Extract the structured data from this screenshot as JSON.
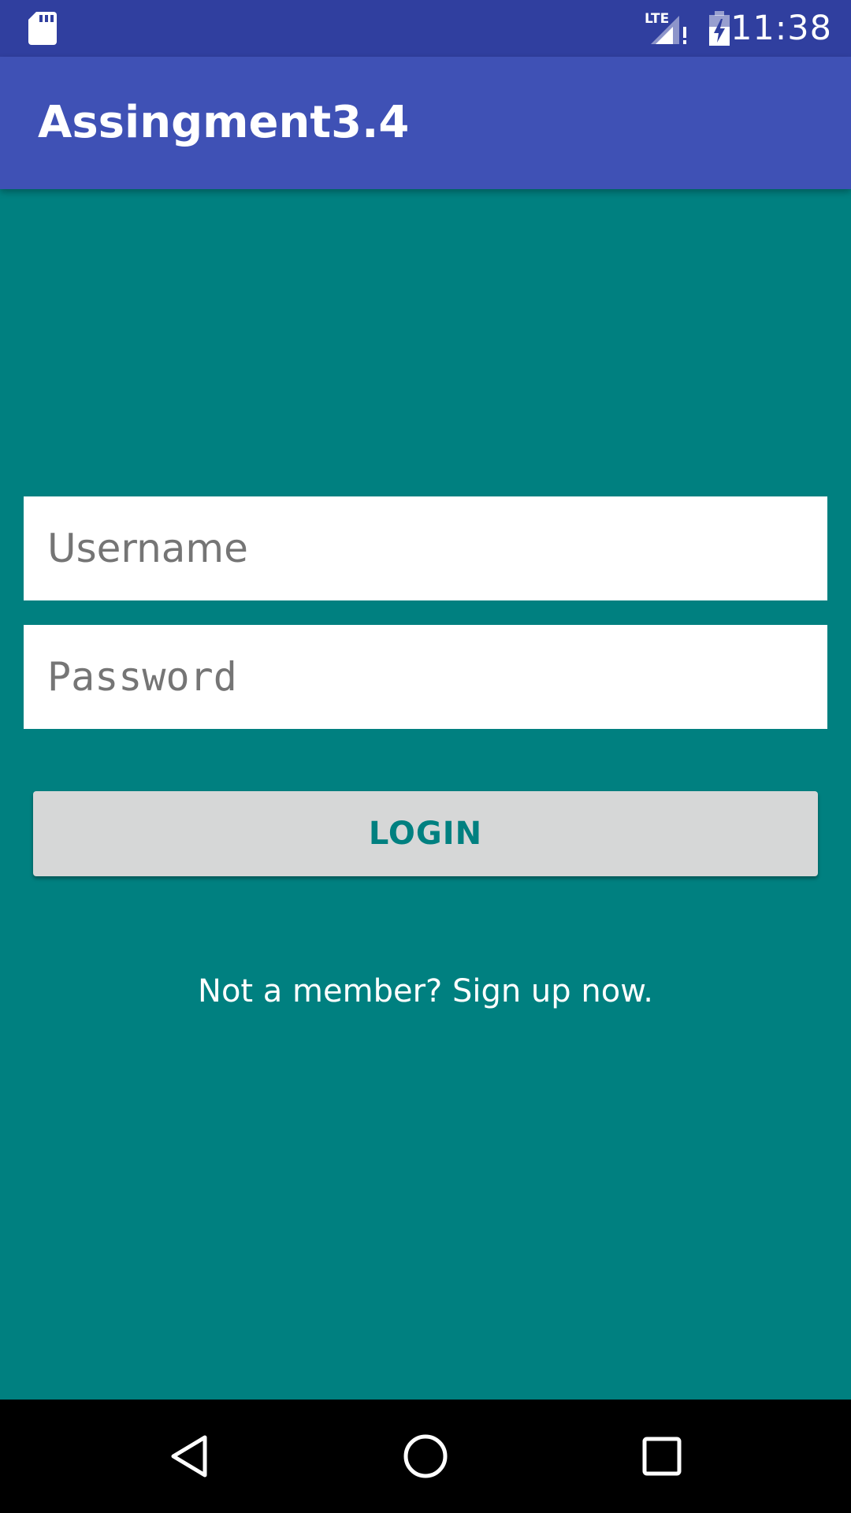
{
  "status_bar": {
    "time": "11:38",
    "network": "LTE",
    "icons": [
      "sd-card-icon",
      "lte-signal-icon",
      "battery-charging-icon"
    ]
  },
  "app_bar": {
    "title": "Assingment3.4"
  },
  "form": {
    "username": {
      "placeholder": "Username",
      "value": ""
    },
    "password": {
      "placeholder": "Password",
      "value": ""
    },
    "login_label": "LOGIN",
    "signup_text": "Not a member? Sign up now."
  },
  "nav_bar": {
    "icons": [
      "back-icon",
      "home-icon",
      "recents-icon"
    ]
  },
  "colors": {
    "status_bar": "#303F9F",
    "app_bar": "#3F51B5",
    "background": "#008080",
    "button": "#D6D7D7",
    "button_text": "#008080"
  }
}
